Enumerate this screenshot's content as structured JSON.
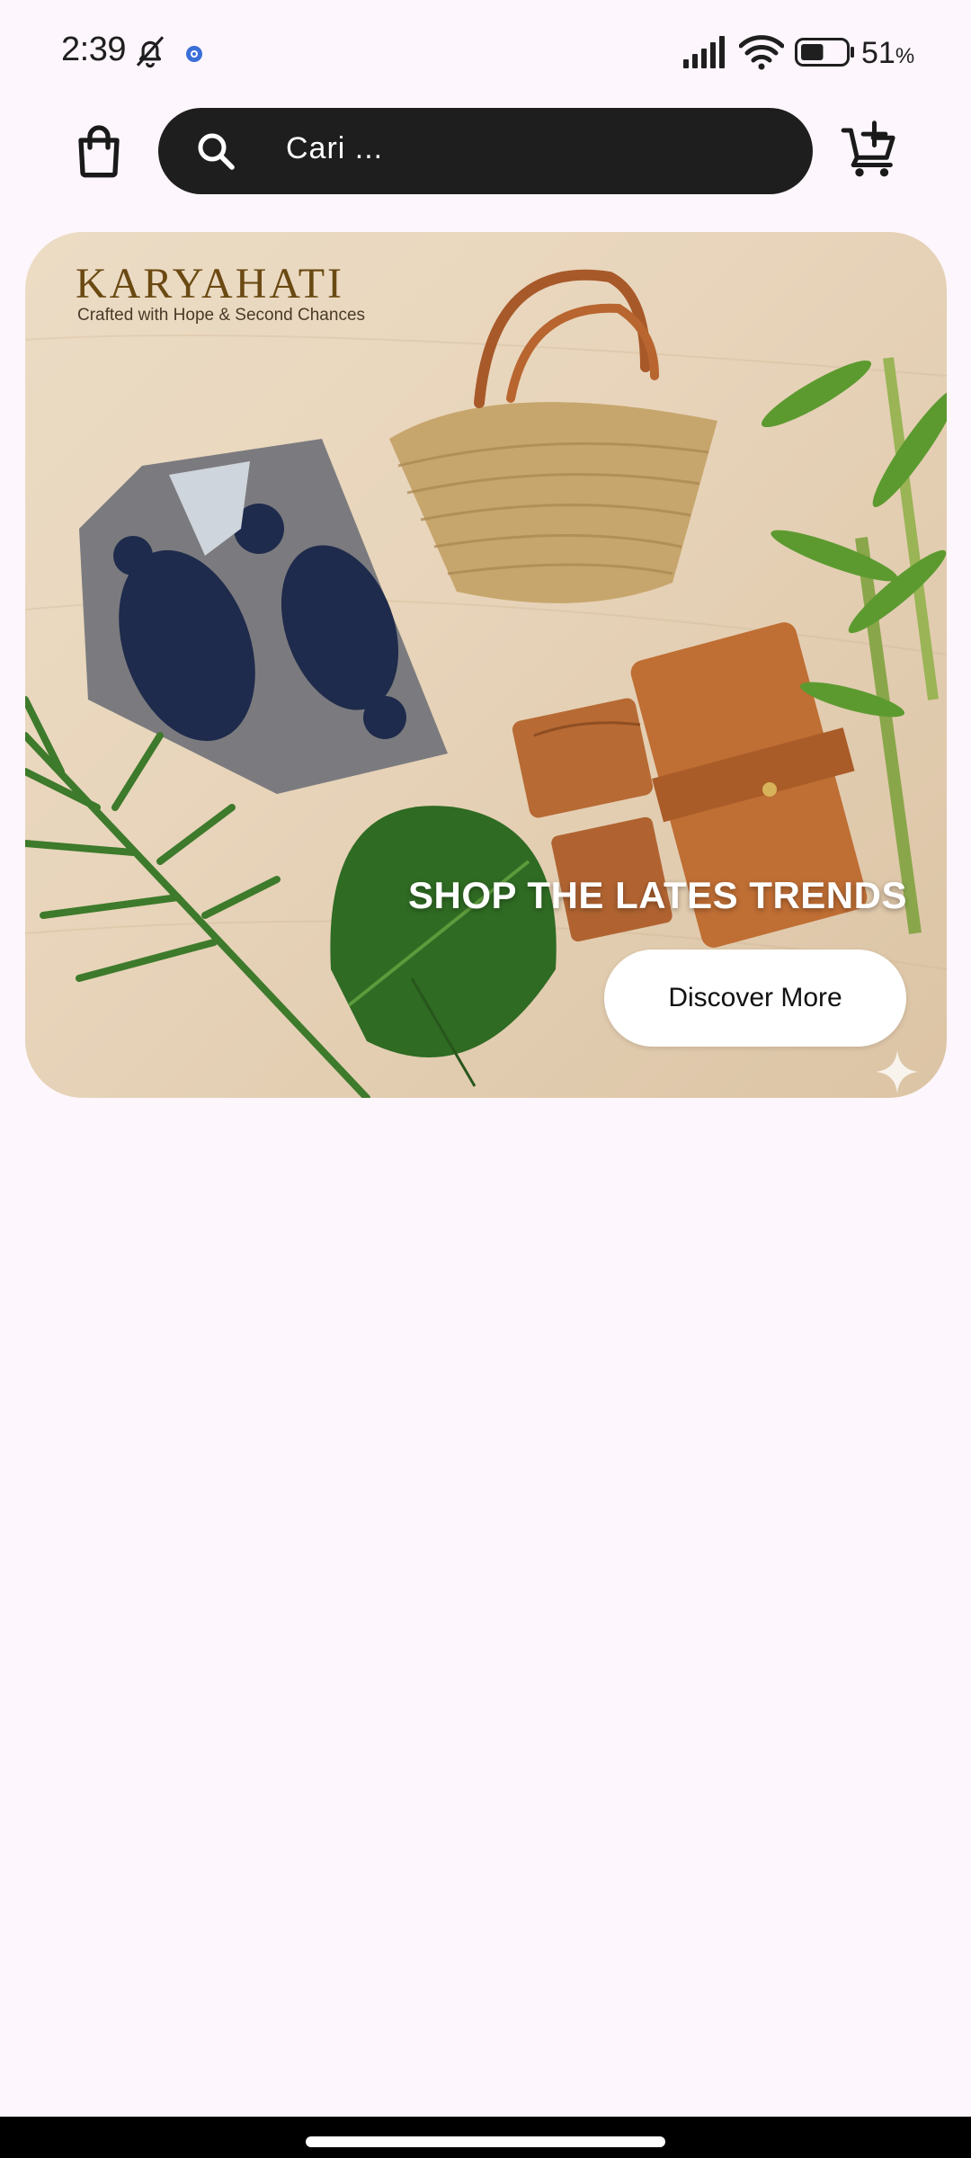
{
  "status_bar": {
    "time": "2:39",
    "battery_value": "51",
    "battery_unit": "%",
    "battery_level": 0.51,
    "icons": [
      "bell-off-icon",
      "app-notification-icon",
      "signal-icon",
      "wifi-icon",
      "battery-icon"
    ]
  },
  "header": {
    "logo_icon": "shopping-bag-icon",
    "search": {
      "placeholder": "Cari ...",
      "icon": "search-icon"
    },
    "cart_icon": "add-to-cart-icon"
  },
  "banner": {
    "brand_name": "KARYAHATI",
    "brand_tagline": "Crafted with Hope & Second Chances",
    "headline": "SHOP THE LATES TRENDS",
    "button_label": "Discover More"
  },
  "colors": {
    "background": "#fdf6fc",
    "search_bar": "#1e1e1e",
    "brand": "#6a4a12",
    "button_bg": "#ffffff"
  }
}
